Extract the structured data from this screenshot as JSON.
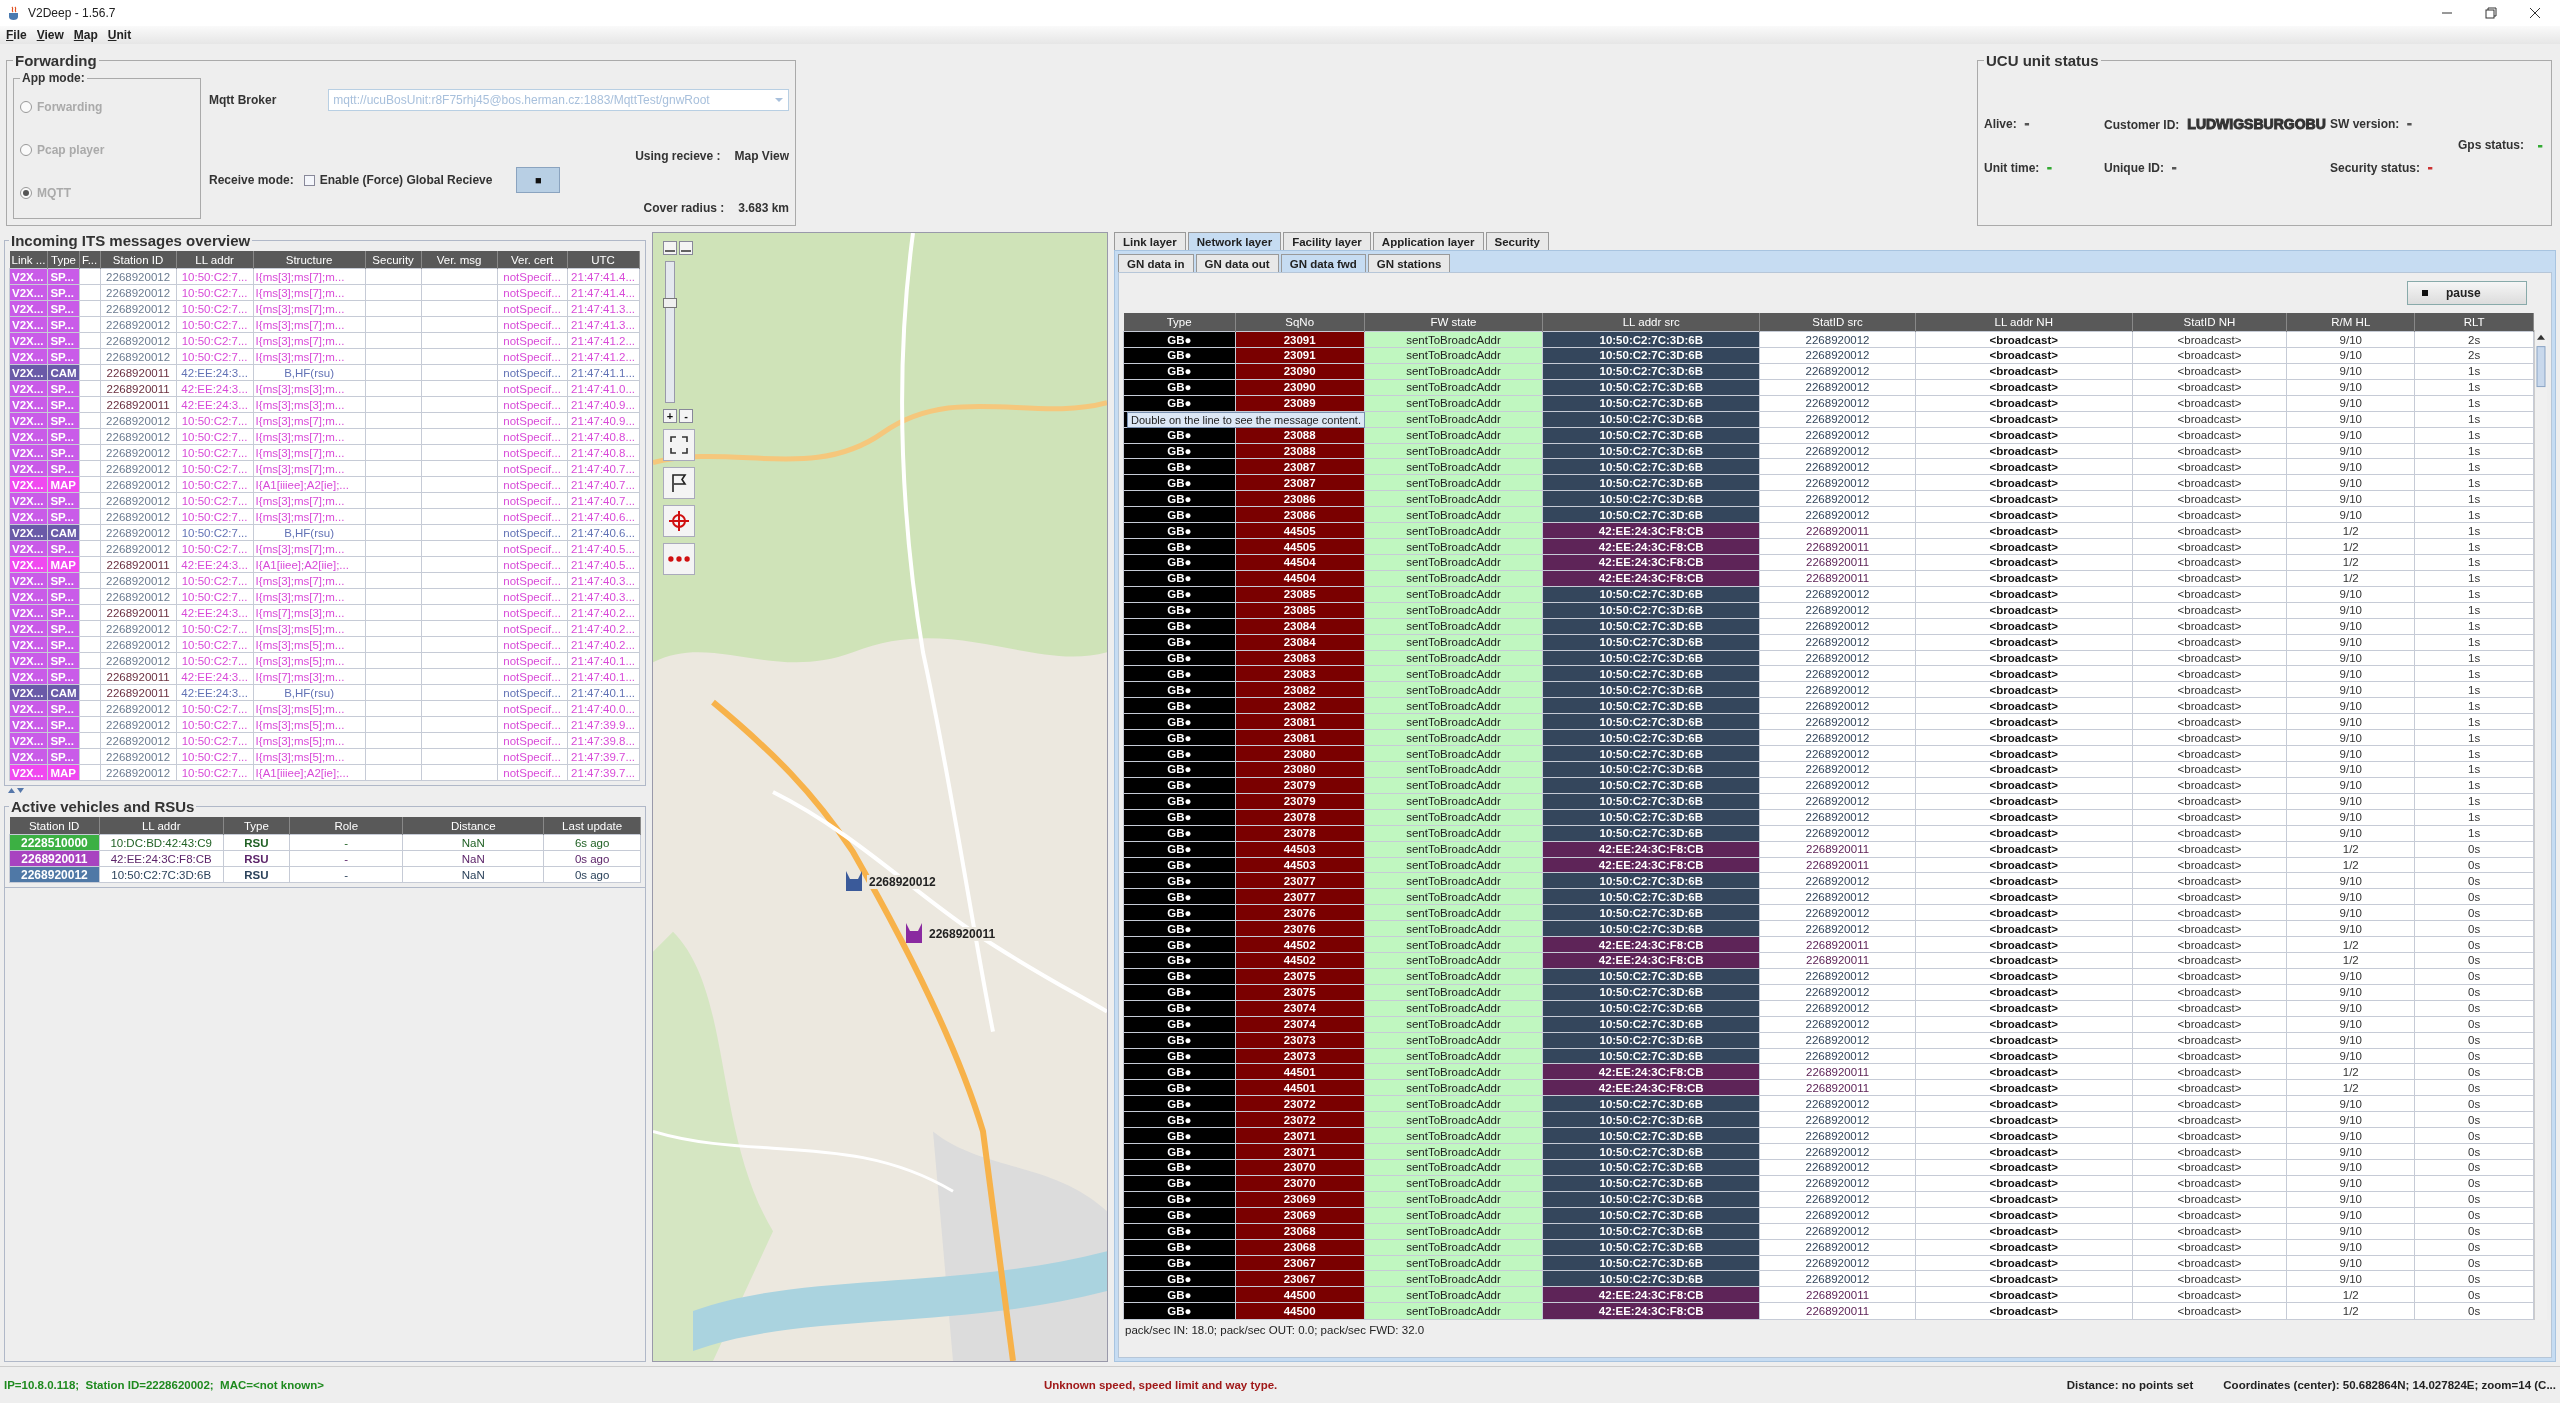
{
  "window": {
    "title": "V2Deep - 1.56.7"
  },
  "menu": [
    "File",
    "View",
    "Map",
    "Unit"
  ],
  "forwarding": {
    "title": "Forwarding",
    "app_mode": {
      "title": "App mode:",
      "disabled": true,
      "options": [
        {
          "label": "Forwarding",
          "selected": false
        },
        {
          "label": "Pcap player",
          "selected": false
        },
        {
          "label": "MQTT",
          "selected": true
        }
      ]
    },
    "broker_label": "Mqtt Broker",
    "broker": {
      "value": "mqtt://ucuBosUnit:r8F75rhj45@bos.herman.cz:1883/MqttTest/gnwRoot",
      "disabled": true
    },
    "using_label": "Using recieve :",
    "using_value": "Map View",
    "receive_label": "Receive mode:",
    "global_receive": {
      "label": "Enable (Force) Global Recieve",
      "checked": false
    },
    "stop_button": "■",
    "cover_label": "Cover radius :",
    "cover_value": "3.683 km"
  },
  "ucu_status": {
    "title": "UCU unit status",
    "fields": [
      {
        "label": "Alive:",
        "value": "-",
        "color": "#555555"
      },
      {
        "label": "Customer ID:",
        "value": "LUDWIGSBURGOBU",
        "color": "#333333"
      },
      {
        "label": "SW version:",
        "value": "-",
        "color": "#555555"
      },
      {
        "label": "Unit time:",
        "value": "-",
        "color": "#33aa33"
      },
      {
        "label": "Unique ID:",
        "value": "-",
        "color": "#555555"
      },
      {
        "label": "Security status:",
        "value": "-",
        "color": "#cc3333"
      }
    ],
    "gps": {
      "label": "Gps status:",
      "value": "-",
      "color": "#33aa33"
    }
  },
  "incoming": {
    "title": "Incoming ITS messages overview",
    "columns": [
      "Link ...",
      "Type",
      "F...",
      "Station ID",
      "LL addr",
      "Structure",
      "Security",
      "Ver. msg",
      "Ver. cert",
      "UTC"
    ],
    "rows": [
      {
        "kind": "sp",
        "link": "V2X...",
        "type": "SP...",
        "station_id": "2268920012",
        "color": "#6b7b90",
        "ll_addr": "10:50:C2:7...",
        "structure": "I{ms[3];ms[7];m...",
        "ver_cert": "notSpecif...",
        "utc": "21:47:41.4..."
      },
      {
        "kind": "sp",
        "link": "V2X...",
        "type": "SP...",
        "station_id": "2268920012",
        "color": "#6b7b90",
        "ll_addr": "10:50:C2:7...",
        "structure": "I{ms[3];ms[7];m...",
        "ver_cert": "notSpecif...",
        "utc": "21:47:41.4..."
      },
      {
        "kind": "sp",
        "link": "V2X...",
        "type": "SP...",
        "station_id": "2268920012",
        "color": "#6b7b90",
        "ll_addr": "10:50:C2:7...",
        "structure": "I{ms[3];ms[7];m...",
        "ver_cert": "notSpecif...",
        "utc": "21:47:41.3..."
      },
      {
        "kind": "sp",
        "link": "V2X...",
        "type": "SP...",
        "station_id": "2268920012",
        "color": "#6b7b90",
        "ll_addr": "10:50:C2:7...",
        "structure": "I{ms[3];ms[7];m...",
        "ver_cert": "notSpecif...",
        "utc": "21:47:41.3..."
      },
      {
        "kind": "sp",
        "link": "V2X...",
        "type": "SP...",
        "station_id": "2268920012",
        "color": "#6b7b90",
        "ll_addr": "10:50:C2:7...",
        "structure": "I{ms[3];ms[7];m...",
        "ver_cert": "notSpecif...",
        "utc": "21:47:41.2..."
      },
      {
        "kind": "sp",
        "link": "V2X...",
        "type": "SP...",
        "station_id": "2268920012",
        "color": "#6b7b90",
        "ll_addr": "10:50:C2:7...",
        "structure": "I{ms[3];ms[7];m...",
        "ver_cert": "notSpecif...",
        "utc": "21:47:41.2..."
      },
      {
        "kind": "cam",
        "link": "V2X...",
        "type": "CAM",
        "station_id": "2268920011",
        "color": "#6a3040",
        "ll_addr": "42:EE:24:3...",
        "structure": "B,HF(rsu)",
        "ver_cert": "notSpecif...",
        "utc": "21:47:41.1..."
      },
      {
        "kind": "sp",
        "link": "V2X...",
        "type": "SP...",
        "station_id": "2268920011",
        "color": "#6a3040",
        "ll_addr": "42:EE:24:3...",
        "structure": "I{ms[3];ms[3];m...",
        "ver_cert": "notSpecif...",
        "utc": "21:47:41.0..."
      },
      {
        "kind": "sp",
        "link": "V2X...",
        "type": "SP...",
        "station_id": "2268920011",
        "color": "#6a3040",
        "ll_addr": "42:EE:24:3...",
        "structure": "I{ms[3];ms[3];m...",
        "ver_cert": "notSpecif...",
        "utc": "21:47:40.9..."
      },
      {
        "kind": "sp",
        "link": "V2X...",
        "type": "SP...",
        "station_id": "2268920012",
        "color": "#6b7b90",
        "ll_addr": "10:50:C2:7...",
        "structure": "I{ms[3];ms[7];m...",
        "ver_cert": "notSpecif...",
        "utc": "21:47:40.9..."
      },
      {
        "kind": "sp",
        "link": "V2X...",
        "type": "SP...",
        "station_id": "2268920012",
        "color": "#6b7b90",
        "ll_addr": "10:50:C2:7...",
        "structure": "I{ms[3];ms[7];m...",
        "ver_cert": "notSpecif...",
        "utc": "21:47:40.8..."
      },
      {
        "kind": "sp",
        "link": "V2X...",
        "type": "SP...",
        "station_id": "2268920012",
        "color": "#6b7b90",
        "ll_addr": "10:50:C2:7...",
        "structure": "I{ms[3];ms[7];m...",
        "ver_cert": "notSpecif...",
        "utc": "21:47:40.8..."
      },
      {
        "kind": "sp",
        "link": "V2X...",
        "type": "SP...",
        "station_id": "2268920012",
        "color": "#6b7b90",
        "ll_addr": "10:50:C2:7...",
        "structure": "I{ms[3];ms[7];m...",
        "ver_cert": "notSpecif...",
        "utc": "21:47:40.7..."
      },
      {
        "kind": "map",
        "link": "V2X...",
        "type": "MAP",
        "station_id": "2268920012",
        "color": "#6b7b90",
        "ll_addr": "10:50:C2:7...",
        "structure": "I{A1[iiiee];A2[ie];...",
        "ver_cert": "notSpecif...",
        "utc": "21:47:40.7..."
      },
      {
        "kind": "sp",
        "link": "V2X...",
        "type": "SP...",
        "station_id": "2268920012",
        "color": "#6b7b90",
        "ll_addr": "10:50:C2:7...",
        "structure": "I{ms[3];ms[7];m...",
        "ver_cert": "notSpecif...",
        "utc": "21:47:40.7..."
      },
      {
        "kind": "sp",
        "link": "V2X...",
        "type": "SP...",
        "station_id": "2268920012",
        "color": "#6b7b90",
        "ll_addr": "10:50:C2:7...",
        "structure": "I{ms[3];ms[7];m...",
        "ver_cert": "notSpecif...",
        "utc": "21:47:40.6..."
      },
      {
        "kind": "cam",
        "link": "V2X...",
        "type": "CAM",
        "station_id": "2268920012",
        "color": "#6b7b90",
        "ll_addr": "10:50:C2:7...",
        "structure": "B,HF(rsu)",
        "ver_cert": "notSpecif...",
        "utc": "21:47:40.6..."
      },
      {
        "kind": "sp",
        "link": "V2X...",
        "type": "SP...",
        "station_id": "2268920012",
        "color": "#6b7b90",
        "ll_addr": "10:50:C2:7...",
        "structure": "I{ms[3];ms[7];m...",
        "ver_cert": "notSpecif...",
        "utc": "21:47:40.5..."
      },
      {
        "kind": "map",
        "link": "V2X...",
        "type": "MAP",
        "station_id": "2268920011",
        "color": "#6a3040",
        "ll_addr": "42:EE:24:3...",
        "structure": "I{A1[iiee];A2[iie];...",
        "ver_cert": "notSpecif...",
        "utc": "21:47:40.5..."
      },
      {
        "kind": "sp",
        "link": "V2X...",
        "type": "SP...",
        "station_id": "2268920012",
        "color": "#6b7b90",
        "ll_addr": "10:50:C2:7...",
        "structure": "I{ms[3];ms[7];m...",
        "ver_cert": "notSpecif...",
        "utc": "21:47:40.3..."
      },
      {
        "kind": "sp",
        "link": "V2X...",
        "type": "SP...",
        "station_id": "2268920012",
        "color": "#6b7b90",
        "ll_addr": "10:50:C2:7...",
        "structure": "I{ms[3];ms[7];m...",
        "ver_cert": "notSpecif...",
        "utc": "21:47:40.3..."
      },
      {
        "kind": "sp",
        "link": "V2X...",
        "type": "SP...",
        "station_id": "2268920011",
        "color": "#6a3040",
        "ll_addr": "42:EE:24:3...",
        "structure": "I{ms[7];ms[3];m...",
        "ver_cert": "notSpecif...",
        "utc": "21:47:40.2..."
      },
      {
        "kind": "sp",
        "link": "V2X...",
        "type": "SP...",
        "station_id": "2268920012",
        "color": "#6b7b90",
        "ll_addr": "10:50:C2:7...",
        "structure": "I{ms[3];ms[5];m...",
        "ver_cert": "notSpecif...",
        "utc": "21:47:40.2..."
      },
      {
        "kind": "sp",
        "link": "V2X...",
        "type": "SP...",
        "station_id": "2268920012",
        "color": "#6b7b90",
        "ll_addr": "10:50:C2:7...",
        "structure": "I{ms[3];ms[5];m...",
        "ver_cert": "notSpecif...",
        "utc": "21:47:40.2..."
      },
      {
        "kind": "sp",
        "link": "V2X...",
        "type": "SP...",
        "station_id": "2268920012",
        "color": "#6b7b90",
        "ll_addr": "10:50:C2:7...",
        "structure": "I{ms[3];ms[5];m...",
        "ver_cert": "notSpecif...",
        "utc": "21:47:40.1..."
      },
      {
        "kind": "sp",
        "link": "V2X...",
        "type": "SP...",
        "station_id": "2268920011",
        "color": "#6a3040",
        "ll_addr": "42:EE:24:3...",
        "structure": "I{ms[7];ms[3];m...",
        "ver_cert": "notSpecif...",
        "utc": "21:47:40.1..."
      },
      {
        "kind": "cam",
        "link": "V2X...",
        "type": "CAM",
        "station_id": "2268920011",
        "color": "#6a3040",
        "ll_addr": "42:EE:24:3...",
        "structure": "B,HF(rsu)",
        "ver_cert": "notSpecif...",
        "utc": "21:47:40.1..."
      },
      {
        "kind": "sp",
        "link": "V2X...",
        "type": "SP...",
        "station_id": "2268920012",
        "color": "#6b7b90",
        "ll_addr": "10:50:C2:7...",
        "structure": "I{ms[3];ms[5];m...",
        "ver_cert": "notSpecif...",
        "utc": "21:47:40.0..."
      },
      {
        "kind": "sp",
        "link": "V2X...",
        "type": "SP...",
        "station_id": "2268920012",
        "color": "#6b7b90",
        "ll_addr": "10:50:C2:7...",
        "structure": "I{ms[3];ms[5];m...",
        "ver_cert": "notSpecif...",
        "utc": "21:47:39.9..."
      },
      {
        "kind": "sp",
        "link": "V2X...",
        "type": "SP...",
        "station_id": "2268920012",
        "color": "#6b7b90",
        "ll_addr": "10:50:C2:7...",
        "structure": "I{ms[3];ms[5];m...",
        "ver_cert": "notSpecif...",
        "utc": "21:47:39.8..."
      },
      {
        "kind": "sp",
        "link": "V2X...",
        "type": "SP...",
        "station_id": "2268920012",
        "color": "#6b7b90",
        "ll_addr": "10:50:C2:7...",
        "structure": "I{ms[3];ms[5];m...",
        "ver_cert": "notSpecif...",
        "utc": "21:47:39.7..."
      },
      {
        "kind": "map",
        "link": "V2X...",
        "type": "MAP",
        "station_id": "2268920012",
        "color": "#6b7b90",
        "ll_addr": "10:50:C2:7...",
        "structure": "I{A1[iiiee];A2[ie];...",
        "ver_cert": "notSpecif...",
        "utc": "21:47:39.7..."
      }
    ]
  },
  "active": {
    "title": "Active vehicles and RSUs",
    "columns": [
      "Station ID",
      "LL addr",
      "Type",
      "Role",
      "Distance",
      "Last update"
    ],
    "rows": [
      {
        "station_id": "2228510000",
        "color": "#3cb043",
        "ll_addr": "10:DC:BD:42:43:C9",
        "type": "RSU",
        "role": "-",
        "distance": "NaN",
        "last_update": "6s ago"
      },
      {
        "station_id": "2268920011",
        "color": "#a843c0",
        "ll_addr": "42:EE:24:3C:F8:CB",
        "type": "RSU",
        "role": "-",
        "distance": "NaN",
        "last_update": "0s ago"
      },
      {
        "station_id": "2268920012",
        "color": "#4f78a6",
        "ll_addr": "10:50:C2:7C:3D:6B",
        "type": "RSU",
        "role": "-",
        "distance": "NaN",
        "last_update": "0s ago"
      }
    ]
  },
  "map": {
    "zoom_slider": {
      "level": 0.72
    },
    "zoom_buttons": [
      "+",
      "-"
    ],
    "markers": [
      {
        "label": "2268920012",
        "color": "#3a5a9a"
      },
      {
        "label": "2268920011",
        "color": "#8a2aa0"
      }
    ]
  },
  "network": {
    "layer_tabs": [
      {
        "label": "Link layer",
        "selected": false
      },
      {
        "label": "Network layer",
        "selected": true
      },
      {
        "label": "Facility layer",
        "selected": false
      },
      {
        "label": "Application layer",
        "selected": false
      },
      {
        "label": "Security",
        "selected": false
      }
    ],
    "sub_tabs": [
      {
        "label": "GN data in",
        "selected": false
      },
      {
        "label": "GN data out",
        "selected": false
      },
      {
        "label": "GN data fwd",
        "selected": true
      },
      {
        "label": "GN stations",
        "selected": false
      }
    ],
    "pause_label": "pause",
    "columns": [
      "Type",
      "SqNo",
      "FW state",
      "LL addr src",
      "StatID src",
      "LL addr NH",
      "StatID NH",
      "R/M HL",
      "RLT"
    ],
    "tooltip": "Double on the line to see the message content.",
    "rows": [
      {
        "type": "GB●",
        "sq_no": "23091",
        "fw_state": "sentToBroadcAddr",
        "ll_addr_src": "10:50:C2:7C:3D:6B",
        "stat_id_src": "2268920012",
        "color": "#34465c",
        "ll_addr_nh": "<broadcast>",
        "stat_id_nh": "<broadcast>",
        "rm_hl": "9/10",
        "rlt": "2s"
      },
      {
        "type": "GB●",
        "sq_no": "23091",
        "fw_state": "sentToBroadcAddr",
        "ll_addr_src": "10:50:C2:7C:3D:6B",
        "stat_id_src": "2268920012",
        "color": "#34465c",
        "ll_addr_nh": "<broadcast>",
        "stat_id_nh": "<broadcast>",
        "rm_hl": "9/10",
        "rlt": "2s"
      },
      {
        "type": "GB●",
        "sq_no": "23090",
        "fw_state": "sentToBroadcAddr",
        "ll_addr_src": "10:50:C2:7C:3D:6B",
        "stat_id_src": "2268920012",
        "color": "#34465c",
        "ll_addr_nh": "<broadcast>",
        "stat_id_nh": "<broadcast>",
        "rm_hl": "9/10",
        "rlt": "1s"
      },
      {
        "type": "GB●",
        "sq_no": "23090",
        "fw_state": "sentToBroadcAddr",
        "ll_addr_src": "10:50:C2:7C:3D:6B",
        "stat_id_src": "2268920012",
        "color": "#34465c",
        "ll_addr_nh": "<broadcast>",
        "stat_id_nh": "<broadcast>",
        "rm_hl": "9/10",
        "rlt": "1s"
      },
      {
        "type": "GB●",
        "sq_no": "23089",
        "fw_state": "sentToBroadcAddr",
        "ll_addr_src": "10:50:C2:7C:3D:6B",
        "stat_id_src": "2268920012",
        "color": "#34465c",
        "ll_addr_nh": "<broadcast>",
        "stat_id_nh": "<broadcast>",
        "rm_hl": "9/10",
        "rlt": "1s"
      },
      {
        "fw_state": "sentToBroadcAddr",
        "ll_addr_src": "10:50:C2:7C:3D:6B",
        "stat_id_src": "2268920012",
        "color": "#34465c",
        "ll_addr_nh": "<broadcast>",
        "stat_id_nh": "<broadcast>",
        "rm_hl": "9/10",
        "rlt": "1s"
      },
      {
        "type": "GB●",
        "sq_no": "23088",
        "fw_state": "sentToBroadcAddr",
        "ll_addr_src": "10:50:C2:7C:3D:6B",
        "stat_id_src": "2268920012",
        "color": "#34465c",
        "ll_addr_nh": "<broadcast>",
        "stat_id_nh": "<broadcast>",
        "rm_hl": "9/10",
        "rlt": "1s"
      },
      {
        "type": "GB●",
        "sq_no": "23088",
        "fw_state": "sentToBroadcAddr",
        "ll_addr_src": "10:50:C2:7C:3D:6B",
        "stat_id_src": "2268920012",
        "color": "#34465c",
        "ll_addr_nh": "<broadcast>",
        "stat_id_nh": "<broadcast>",
        "rm_hl": "9/10",
        "rlt": "1s"
      },
      {
        "type": "GB●",
        "sq_no": "23087",
        "fw_state": "sentToBroadcAddr",
        "ll_addr_src": "10:50:C2:7C:3D:6B",
        "stat_id_src": "2268920012",
        "color": "#34465c",
        "ll_addr_nh": "<broadcast>",
        "stat_id_nh": "<broadcast>",
        "rm_hl": "9/10",
        "rlt": "1s"
      },
      {
        "type": "GB●",
        "sq_no": "23087",
        "fw_state": "sentToBroadcAddr",
        "ll_addr_src": "10:50:C2:7C:3D:6B",
        "stat_id_src": "2268920012",
        "color": "#34465c",
        "ll_addr_nh": "<broadcast>",
        "stat_id_nh": "<broadcast>",
        "rm_hl": "9/10",
        "rlt": "1s"
      },
      {
        "type": "GB●",
        "sq_no": "23086",
        "fw_state": "sentToBroadcAddr",
        "ll_addr_src": "10:50:C2:7C:3D:6B",
        "stat_id_src": "2268920012",
        "color": "#34465c",
        "ll_addr_nh": "<broadcast>",
        "stat_id_nh": "<broadcast>",
        "rm_hl": "9/10",
        "rlt": "1s"
      },
      {
        "type": "GB●",
        "sq_no": "23086",
        "fw_state": "sentToBroadcAddr",
        "ll_addr_src": "10:50:C2:7C:3D:6B",
        "stat_id_src": "2268920012",
        "color": "#34465c",
        "ll_addr_nh": "<broadcast>",
        "stat_id_nh": "<broadcast>",
        "rm_hl": "9/10",
        "rlt": "1s"
      },
      {
        "type": "GB●",
        "sq_no": "44505",
        "fw_state": "sentToBroadcAddr",
        "ll_addr_src": "42:EE:24:3C:F8:CB",
        "stat_id_src": "2268920011",
        "color": "#5e2458",
        "ll_addr_nh": "<broadcast>",
        "stat_id_nh": "<broadcast>",
        "rm_hl": "1/2",
        "rlt": "1s"
      },
      {
        "type": "GB●",
        "sq_no": "44505",
        "fw_state": "sentToBroadcAddr",
        "ll_addr_src": "42:EE:24:3C:F8:CB",
        "stat_id_src": "2268920011",
        "color": "#5e2458",
        "ll_addr_nh": "<broadcast>",
        "stat_id_nh": "<broadcast>",
        "rm_hl": "1/2",
        "rlt": "1s"
      },
      {
        "type": "GB●",
        "sq_no": "44504",
        "fw_state": "sentToBroadcAddr",
        "ll_addr_src": "42:EE:24:3C:F8:CB",
        "stat_id_src": "2268920011",
        "color": "#5e2458",
        "ll_addr_nh": "<broadcast>",
        "stat_id_nh": "<broadcast>",
        "rm_hl": "1/2",
        "rlt": "1s"
      },
      {
        "type": "GB●",
        "sq_no": "44504",
        "fw_state": "sentToBroadcAddr",
        "ll_addr_src": "42:EE:24:3C:F8:CB",
        "stat_id_src": "2268920011",
        "color": "#5e2458",
        "ll_addr_nh": "<broadcast>",
        "stat_id_nh": "<broadcast>",
        "rm_hl": "1/2",
        "rlt": "1s"
      },
      {
        "type": "GB●",
        "sq_no": "23085",
        "fw_state": "sentToBroadcAddr",
        "ll_addr_src": "10:50:C2:7C:3D:6B",
        "stat_id_src": "2268920012",
        "color": "#34465c",
        "ll_addr_nh": "<broadcast>",
        "stat_id_nh": "<broadcast>",
        "rm_hl": "9/10",
        "rlt": "1s"
      },
      {
        "type": "GB●",
        "sq_no": "23085",
        "fw_state": "sentToBroadcAddr",
        "ll_addr_src": "10:50:C2:7C:3D:6B",
        "stat_id_src": "2268920012",
        "color": "#34465c",
        "ll_addr_nh": "<broadcast>",
        "stat_id_nh": "<broadcast>",
        "rm_hl": "9/10",
        "rlt": "1s"
      },
      {
        "type": "GB●",
        "sq_no": "23084",
        "fw_state": "sentToBroadcAddr",
        "ll_addr_src": "10:50:C2:7C:3D:6B",
        "stat_id_src": "2268920012",
        "color": "#34465c",
        "ll_addr_nh": "<broadcast>",
        "stat_id_nh": "<broadcast>",
        "rm_hl": "9/10",
        "rlt": "1s"
      },
      {
        "type": "GB●",
        "sq_no": "23084",
        "fw_state": "sentToBroadcAddr",
        "ll_addr_src": "10:50:C2:7C:3D:6B",
        "stat_id_src": "2268920012",
        "color": "#34465c",
        "ll_addr_nh": "<broadcast>",
        "stat_id_nh": "<broadcast>",
        "rm_hl": "9/10",
        "rlt": "1s"
      },
      {
        "type": "GB●",
        "sq_no": "23083",
        "fw_state": "sentToBroadcAddr",
        "ll_addr_src": "10:50:C2:7C:3D:6B",
        "stat_id_src": "2268920012",
        "color": "#34465c",
        "ll_addr_nh": "<broadcast>",
        "stat_id_nh": "<broadcast>",
        "rm_hl": "9/10",
        "rlt": "1s"
      },
      {
        "type": "GB●",
        "sq_no": "23083",
        "fw_state": "sentToBroadcAddr",
        "ll_addr_src": "10:50:C2:7C:3D:6B",
        "stat_id_src": "2268920012",
        "color": "#34465c",
        "ll_addr_nh": "<broadcast>",
        "stat_id_nh": "<broadcast>",
        "rm_hl": "9/10",
        "rlt": "1s"
      },
      {
        "type": "GB●",
        "sq_no": "23082",
        "fw_state": "sentToBroadcAddr",
        "ll_addr_src": "10:50:C2:7C:3D:6B",
        "stat_id_src": "2268920012",
        "color": "#34465c",
        "ll_addr_nh": "<broadcast>",
        "stat_id_nh": "<broadcast>",
        "rm_hl": "9/10",
        "rlt": "1s"
      },
      {
        "type": "GB●",
        "sq_no": "23082",
        "fw_state": "sentToBroadcAddr",
        "ll_addr_src": "10:50:C2:7C:3D:6B",
        "stat_id_src": "2268920012",
        "color": "#34465c",
        "ll_addr_nh": "<broadcast>",
        "stat_id_nh": "<broadcast>",
        "rm_hl": "9/10",
        "rlt": "1s"
      },
      {
        "type": "GB●",
        "sq_no": "23081",
        "fw_state": "sentToBroadcAddr",
        "ll_addr_src": "10:50:C2:7C:3D:6B",
        "stat_id_src": "2268920012",
        "color": "#34465c",
        "ll_addr_nh": "<broadcast>",
        "stat_id_nh": "<broadcast>",
        "rm_hl": "9/10",
        "rlt": "1s"
      },
      {
        "type": "GB●",
        "sq_no": "23081",
        "fw_state": "sentToBroadcAddr",
        "ll_addr_src": "10:50:C2:7C:3D:6B",
        "stat_id_src": "2268920012",
        "color": "#34465c",
        "ll_addr_nh": "<broadcast>",
        "stat_id_nh": "<broadcast>",
        "rm_hl": "9/10",
        "rlt": "1s"
      },
      {
        "type": "GB●",
        "sq_no": "23080",
        "fw_state": "sentToBroadcAddr",
        "ll_addr_src": "10:50:C2:7C:3D:6B",
        "stat_id_src": "2268920012",
        "color": "#34465c",
        "ll_addr_nh": "<broadcast>",
        "stat_id_nh": "<broadcast>",
        "rm_hl": "9/10",
        "rlt": "1s"
      },
      {
        "type": "GB●",
        "sq_no": "23080",
        "fw_state": "sentToBroadcAddr",
        "ll_addr_src": "10:50:C2:7C:3D:6B",
        "stat_id_src": "2268920012",
        "color": "#34465c",
        "ll_addr_nh": "<broadcast>",
        "stat_id_nh": "<broadcast>",
        "rm_hl": "9/10",
        "rlt": "1s"
      },
      {
        "type": "GB●",
        "sq_no": "23079",
        "fw_state": "sentToBroadcAddr",
        "ll_addr_src": "10:50:C2:7C:3D:6B",
        "stat_id_src": "2268920012",
        "color": "#34465c",
        "ll_addr_nh": "<broadcast>",
        "stat_id_nh": "<broadcast>",
        "rm_hl": "9/10",
        "rlt": "1s"
      },
      {
        "type": "GB●",
        "sq_no": "23079",
        "fw_state": "sentToBroadcAddr",
        "ll_addr_src": "10:50:C2:7C:3D:6B",
        "stat_id_src": "2268920012",
        "color": "#34465c",
        "ll_addr_nh": "<broadcast>",
        "stat_id_nh": "<broadcast>",
        "rm_hl": "9/10",
        "rlt": "1s"
      },
      {
        "type": "GB●",
        "sq_no": "23078",
        "fw_state": "sentToBroadcAddr",
        "ll_addr_src": "10:50:C2:7C:3D:6B",
        "stat_id_src": "2268920012",
        "color": "#34465c",
        "ll_addr_nh": "<broadcast>",
        "stat_id_nh": "<broadcast>",
        "rm_hl": "9/10",
        "rlt": "1s"
      },
      {
        "type": "GB●",
        "sq_no": "23078",
        "fw_state": "sentToBroadcAddr",
        "ll_addr_src": "10:50:C2:7C:3D:6B",
        "stat_id_src": "2268920012",
        "color": "#34465c",
        "ll_addr_nh": "<broadcast>",
        "stat_id_nh": "<broadcast>",
        "rm_hl": "9/10",
        "rlt": "1s"
      },
      {
        "type": "GB●",
        "sq_no": "44503",
        "fw_state": "sentToBroadcAddr",
        "ll_addr_src": "42:EE:24:3C:F8:CB",
        "stat_id_src": "2268920011",
        "color": "#5e2458",
        "ll_addr_nh": "<broadcast>",
        "stat_id_nh": "<broadcast>",
        "rm_hl": "1/2",
        "rlt": "0s"
      },
      {
        "type": "GB●",
        "sq_no": "44503",
        "fw_state": "sentToBroadcAddr",
        "ll_addr_src": "42:EE:24:3C:F8:CB",
        "stat_id_src": "2268920011",
        "color": "#5e2458",
        "ll_addr_nh": "<broadcast>",
        "stat_id_nh": "<broadcast>",
        "rm_hl": "1/2",
        "rlt": "0s"
      },
      {
        "type": "GB●",
        "sq_no": "23077",
        "fw_state": "sentToBroadcAddr",
        "ll_addr_src": "10:50:C2:7C:3D:6B",
        "stat_id_src": "2268920012",
        "color": "#34465c",
        "ll_addr_nh": "<broadcast>",
        "stat_id_nh": "<broadcast>",
        "rm_hl": "9/10",
        "rlt": "0s"
      },
      {
        "type": "GB●",
        "sq_no": "23077",
        "fw_state": "sentToBroadcAddr",
        "ll_addr_src": "10:50:C2:7C:3D:6B",
        "stat_id_src": "2268920012",
        "color": "#34465c",
        "ll_addr_nh": "<broadcast>",
        "stat_id_nh": "<broadcast>",
        "rm_hl": "9/10",
        "rlt": "0s"
      },
      {
        "type": "GB●",
        "sq_no": "23076",
        "fw_state": "sentToBroadcAddr",
        "ll_addr_src": "10:50:C2:7C:3D:6B",
        "stat_id_src": "2268920012",
        "color": "#34465c",
        "ll_addr_nh": "<broadcast>",
        "stat_id_nh": "<broadcast>",
        "rm_hl": "9/10",
        "rlt": "0s"
      },
      {
        "type": "GB●",
        "sq_no": "23076",
        "fw_state": "sentToBroadcAddr",
        "ll_addr_src": "10:50:C2:7C:3D:6B",
        "stat_id_src": "2268920012",
        "color": "#34465c",
        "ll_addr_nh": "<broadcast>",
        "stat_id_nh": "<broadcast>",
        "rm_hl": "9/10",
        "rlt": "0s"
      },
      {
        "type": "GB●",
        "sq_no": "44502",
        "fw_state": "sentToBroadcAddr",
        "ll_addr_src": "42:EE:24:3C:F8:CB",
        "stat_id_src": "2268920011",
        "color": "#5e2458",
        "ll_addr_nh": "<broadcast>",
        "stat_id_nh": "<broadcast>",
        "rm_hl": "1/2",
        "rlt": "0s"
      },
      {
        "type": "GB●",
        "sq_no": "44502",
        "fw_state": "sentToBroadcAddr",
        "ll_addr_src": "42:EE:24:3C:F8:CB",
        "stat_id_src": "2268920011",
        "color": "#5e2458",
        "ll_addr_nh": "<broadcast>",
        "stat_id_nh": "<broadcast>",
        "rm_hl": "1/2",
        "rlt": "0s"
      },
      {
        "type": "GB●",
        "sq_no": "23075",
        "fw_state": "sentToBroadcAddr",
        "ll_addr_src": "10:50:C2:7C:3D:6B",
        "stat_id_src": "2268920012",
        "color": "#34465c",
        "ll_addr_nh": "<broadcast>",
        "stat_id_nh": "<broadcast>",
        "rm_hl": "9/10",
        "rlt": "0s"
      },
      {
        "type": "GB●",
        "sq_no": "23075",
        "fw_state": "sentToBroadcAddr",
        "ll_addr_src": "10:50:C2:7C:3D:6B",
        "stat_id_src": "2268920012",
        "color": "#34465c",
        "ll_addr_nh": "<broadcast>",
        "stat_id_nh": "<broadcast>",
        "rm_hl": "9/10",
        "rlt": "0s"
      },
      {
        "type": "GB●",
        "sq_no": "23074",
        "fw_state": "sentToBroadcAddr",
        "ll_addr_src": "10:50:C2:7C:3D:6B",
        "stat_id_src": "2268920012",
        "color": "#34465c",
        "ll_addr_nh": "<broadcast>",
        "stat_id_nh": "<broadcast>",
        "rm_hl": "9/10",
        "rlt": "0s"
      },
      {
        "type": "GB●",
        "sq_no": "23074",
        "fw_state": "sentToBroadcAddr",
        "ll_addr_src": "10:50:C2:7C:3D:6B",
        "stat_id_src": "2268920012",
        "color": "#34465c",
        "ll_addr_nh": "<broadcast>",
        "stat_id_nh": "<broadcast>",
        "rm_hl": "9/10",
        "rlt": "0s"
      },
      {
        "type": "GB●",
        "sq_no": "23073",
        "fw_state": "sentToBroadcAddr",
        "ll_addr_src": "10:50:C2:7C:3D:6B",
        "stat_id_src": "2268920012",
        "color": "#34465c",
        "ll_addr_nh": "<broadcast>",
        "stat_id_nh": "<broadcast>",
        "rm_hl": "9/10",
        "rlt": "0s"
      },
      {
        "type": "GB●",
        "sq_no": "23073",
        "fw_state": "sentToBroadcAddr",
        "ll_addr_src": "10:50:C2:7C:3D:6B",
        "stat_id_src": "2268920012",
        "color": "#34465c",
        "ll_addr_nh": "<broadcast>",
        "stat_id_nh": "<broadcast>",
        "rm_hl": "9/10",
        "rlt": "0s"
      },
      {
        "type": "GB●",
        "sq_no": "44501",
        "fw_state": "sentToBroadcAddr",
        "ll_addr_src": "42:EE:24:3C:F8:CB",
        "stat_id_src": "2268920011",
        "color": "#5e2458",
        "ll_addr_nh": "<broadcast>",
        "stat_id_nh": "<broadcast>",
        "rm_hl": "1/2",
        "rlt": "0s"
      },
      {
        "type": "GB●",
        "sq_no": "44501",
        "fw_state": "sentToBroadcAddr",
        "ll_addr_src": "42:EE:24:3C:F8:CB",
        "stat_id_src": "2268920011",
        "color": "#5e2458",
        "ll_addr_nh": "<broadcast>",
        "stat_id_nh": "<broadcast>",
        "rm_hl": "1/2",
        "rlt": "0s"
      },
      {
        "type": "GB●",
        "sq_no": "23072",
        "fw_state": "sentToBroadcAddr",
        "ll_addr_src": "10:50:C2:7C:3D:6B",
        "stat_id_src": "2268920012",
        "color": "#34465c",
        "ll_addr_nh": "<broadcast>",
        "stat_id_nh": "<broadcast>",
        "rm_hl": "9/10",
        "rlt": "0s"
      },
      {
        "type": "GB●",
        "sq_no": "23072",
        "fw_state": "sentToBroadcAddr",
        "ll_addr_src": "10:50:C2:7C:3D:6B",
        "stat_id_src": "2268920012",
        "color": "#34465c",
        "ll_addr_nh": "<broadcast>",
        "stat_id_nh": "<broadcast>",
        "rm_hl": "9/10",
        "rlt": "0s"
      },
      {
        "type": "GB●",
        "sq_no": "23071",
        "fw_state": "sentToBroadcAddr",
        "ll_addr_src": "10:50:C2:7C:3D:6B",
        "stat_id_src": "2268920012",
        "color": "#34465c",
        "ll_addr_nh": "<broadcast>",
        "stat_id_nh": "<broadcast>",
        "rm_hl": "9/10",
        "rlt": "0s"
      },
      {
        "type": "GB●",
        "sq_no": "23071",
        "fw_state": "sentToBroadcAddr",
        "ll_addr_src": "10:50:C2:7C:3D:6B",
        "stat_id_src": "2268920012",
        "color": "#34465c",
        "ll_addr_nh": "<broadcast>",
        "stat_id_nh": "<broadcast>",
        "rm_hl": "9/10",
        "rlt": "0s"
      },
      {
        "type": "GB●",
        "sq_no": "23070",
        "fw_state": "sentToBroadcAddr",
        "ll_addr_src": "10:50:C2:7C:3D:6B",
        "stat_id_src": "2268920012",
        "color": "#34465c",
        "ll_addr_nh": "<broadcast>",
        "stat_id_nh": "<broadcast>",
        "rm_hl": "9/10",
        "rlt": "0s"
      },
      {
        "type": "GB●",
        "sq_no": "23070",
        "fw_state": "sentToBroadcAddr",
        "ll_addr_src": "10:50:C2:7C:3D:6B",
        "stat_id_src": "2268920012",
        "color": "#34465c",
        "ll_addr_nh": "<broadcast>",
        "stat_id_nh": "<broadcast>",
        "rm_hl": "9/10",
        "rlt": "0s"
      },
      {
        "type": "GB●",
        "sq_no": "23069",
        "fw_state": "sentToBroadcAddr",
        "ll_addr_src": "10:50:C2:7C:3D:6B",
        "stat_id_src": "2268920012",
        "color": "#34465c",
        "ll_addr_nh": "<broadcast>",
        "stat_id_nh": "<broadcast>",
        "rm_hl": "9/10",
        "rlt": "0s"
      },
      {
        "type": "GB●",
        "sq_no": "23069",
        "fw_state": "sentToBroadcAddr",
        "ll_addr_src": "10:50:C2:7C:3D:6B",
        "stat_id_src": "2268920012",
        "color": "#34465c",
        "ll_addr_nh": "<broadcast>",
        "stat_id_nh": "<broadcast>",
        "rm_hl": "9/10",
        "rlt": "0s"
      },
      {
        "type": "GB●",
        "sq_no": "23068",
        "fw_state": "sentToBroadcAddr",
        "ll_addr_src": "10:50:C2:7C:3D:6B",
        "stat_id_src": "2268920012",
        "color": "#34465c",
        "ll_addr_nh": "<broadcast>",
        "stat_id_nh": "<broadcast>",
        "rm_hl": "9/10",
        "rlt": "0s"
      },
      {
        "type": "GB●",
        "sq_no": "23068",
        "fw_state": "sentToBroadcAddr",
        "ll_addr_src": "10:50:C2:7C:3D:6B",
        "stat_id_src": "2268920012",
        "color": "#34465c",
        "ll_addr_nh": "<broadcast>",
        "stat_id_nh": "<broadcast>",
        "rm_hl": "9/10",
        "rlt": "0s"
      },
      {
        "type": "GB●",
        "sq_no": "23067",
        "fw_state": "sentToBroadcAddr",
        "ll_addr_src": "10:50:C2:7C:3D:6B",
        "stat_id_src": "2268920012",
        "color": "#34465c",
        "ll_addr_nh": "<broadcast>",
        "stat_id_nh": "<broadcast>",
        "rm_hl": "9/10",
        "rlt": "0s"
      },
      {
        "type": "GB●",
        "sq_no": "23067",
        "fw_state": "sentToBroadcAddr",
        "ll_addr_src": "10:50:C2:7C:3D:6B",
        "stat_id_src": "2268920012",
        "color": "#34465c",
        "ll_addr_nh": "<broadcast>",
        "stat_id_nh": "<broadcast>",
        "rm_hl": "9/10",
        "rlt": "0s"
      },
      {
        "type": "GB●",
        "sq_no": "44500",
        "fw_state": "sentToBroadcAddr",
        "ll_addr_src": "42:EE:24:3C:F8:CB",
        "stat_id_src": "2268920011",
        "color": "#5e2458",
        "ll_addr_nh": "<broadcast>",
        "stat_id_nh": "<broadcast>",
        "rm_hl": "1/2",
        "rlt": "0s"
      },
      {
        "type": "GB●",
        "sq_no": "44500",
        "fw_state": "sentToBroadcAddr",
        "ll_addr_src": "42:EE:24:3C:F8:CB",
        "stat_id_src": "2268920011",
        "color": "#5e2458",
        "ll_addr_nh": "<broadcast>",
        "stat_id_nh": "<broadcast>",
        "rm_hl": "1/2",
        "rlt": "0s"
      }
    ],
    "footer": "pack/sec IN: 18.0; pack/sec OUT: 0.0; pack/sec FWD: 32.0"
  },
  "status_bar": {
    "connection": "IP=10.8.0.118;  Station ID=2228620002;  MAC=<not known>",
    "message": "Unknown speed, speed limit and way type.",
    "distance": "Distance: no points set",
    "coordinates": "Coordinates (center): 50.682864N; 14.027824E; zoom=14 (C..."
  }
}
